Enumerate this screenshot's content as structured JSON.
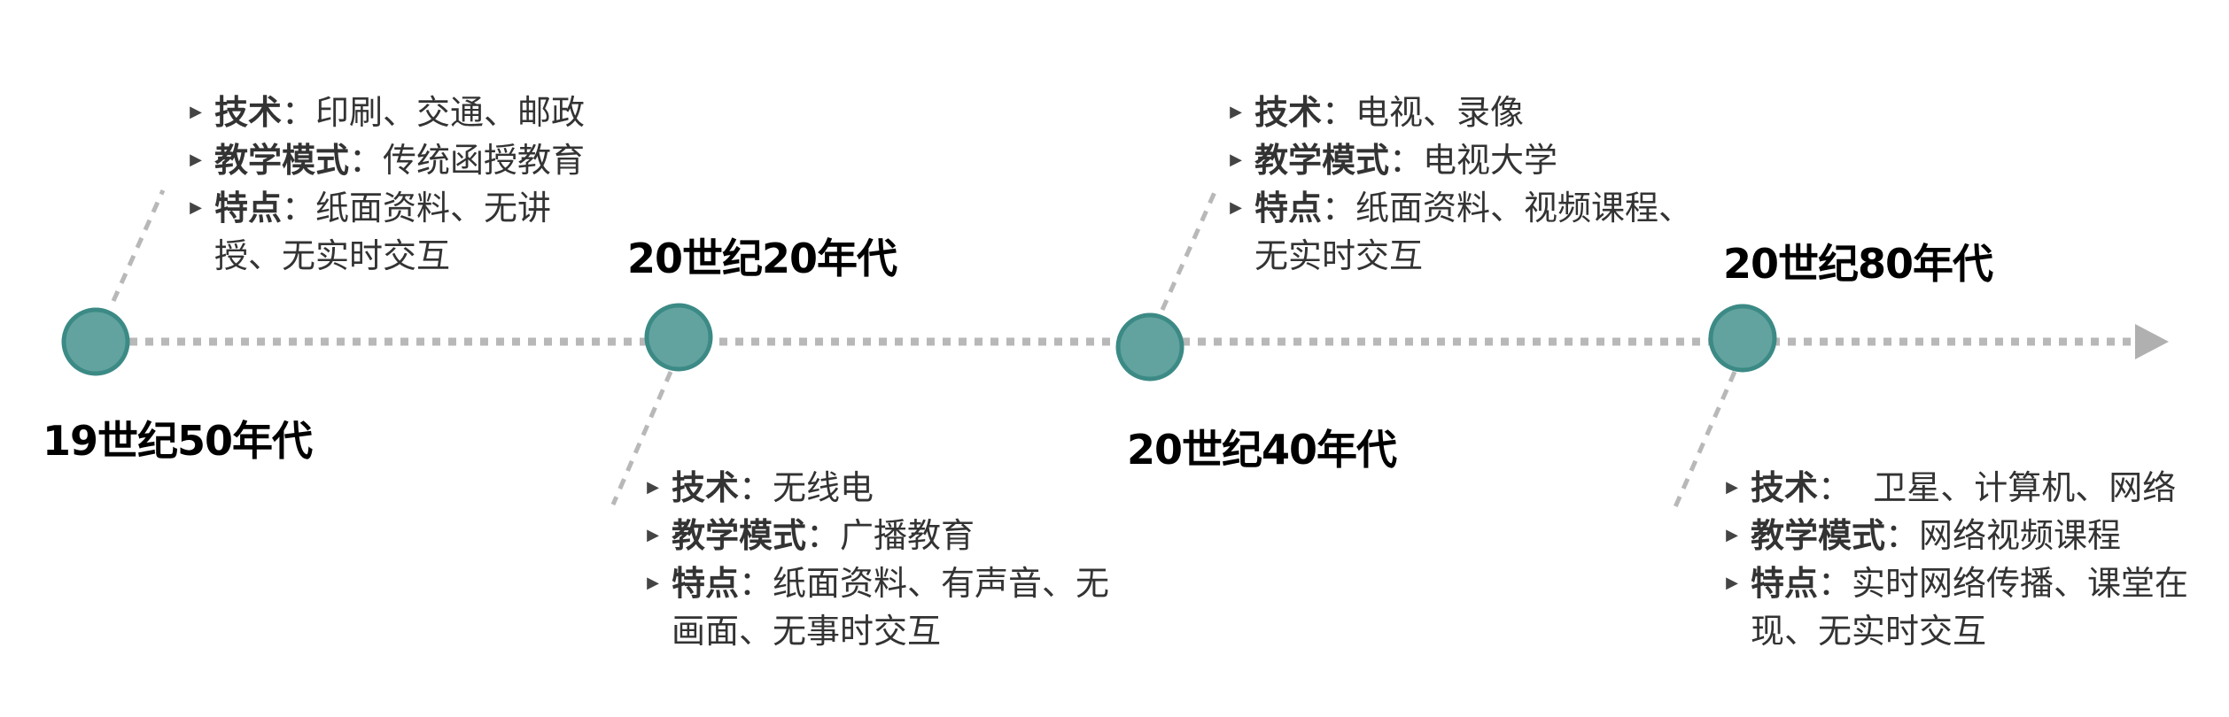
{
  "colors": {
    "node_fill": "#62a39f",
    "node_stroke": "#3c8a85",
    "line": "#b8b8b8",
    "connector": "#b8b8b8"
  },
  "eras": [
    {
      "label": "19世纪50年代",
      "items": [
        {
          "key": "技术",
          "sep": "：",
          "value": "印刷、交通、邮政"
        },
        {
          "key": "教学模式",
          "sep": "：",
          "value": "传统函授教育"
        },
        {
          "key": "特点",
          "sep": "：",
          "value": "纸面资料、无讲",
          "cont": "授、无实时交互"
        }
      ]
    },
    {
      "label": "20世纪20年代",
      "items": [
        {
          "key": "技术",
          "sep": "：",
          "value": "无线电"
        },
        {
          "key": "教学模式",
          "sep": "：",
          "value": "广播教育"
        },
        {
          "key": "特点",
          "sep": "：",
          "value": "纸面资料、有声音、无",
          "cont": "画面、无事时交互"
        }
      ]
    },
    {
      "label": "20世纪40年代",
      "items": [
        {
          "key": "技术",
          "sep": "：",
          "value": "电视、录像"
        },
        {
          "key": "教学模式",
          "sep": "：",
          "value": "电视大学"
        },
        {
          "key": "特点",
          "sep": "：",
          "value": "纸面资料、视频课程、",
          "cont": "无实时交互"
        }
      ]
    },
    {
      "label": "20世纪80年代",
      "items": [
        {
          "key": "技术",
          "sep": "：",
          "value": "  卫星、计算机、网络"
        },
        {
          "key": "教学模式",
          "sep": "：",
          "value": "网络视频课程"
        },
        {
          "key": "特点",
          "sep": "：",
          "value": "实时网络传播、课堂在",
          "cont": "现、无实时交互"
        }
      ]
    }
  ]
}
